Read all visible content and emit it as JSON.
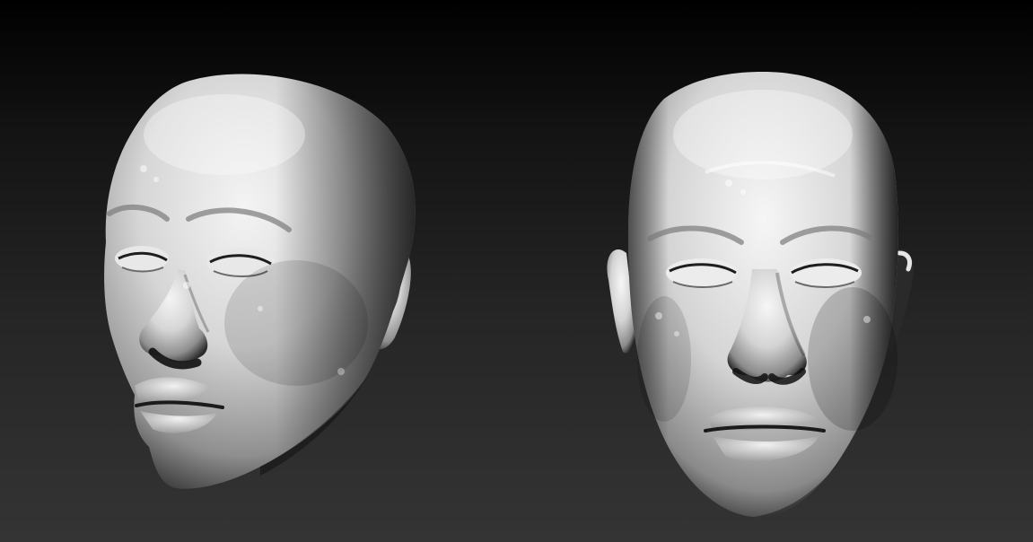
{
  "scene": {
    "background_top": "#000000",
    "background_bottom": "#343434",
    "clay_color": "#d9d9d9",
    "views": [
      {
        "name": "three-quarter-view",
        "subject": "sculpted-head"
      },
      {
        "name": "front-view",
        "subject": "sculpted-head"
      }
    ]
  }
}
